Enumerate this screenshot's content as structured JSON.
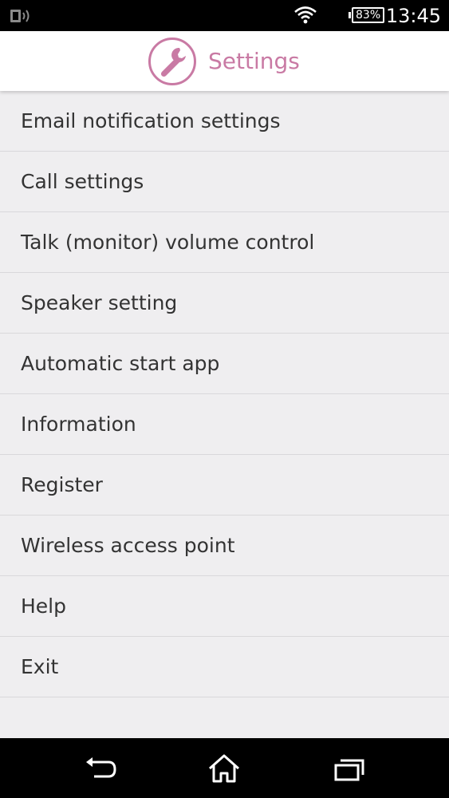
{
  "status_bar": {
    "battery_level": "83%",
    "time": "13:45"
  },
  "header": {
    "title": "Settings",
    "icon": "wrench-icon",
    "accent_color": "#c97aa4"
  },
  "menu": {
    "items": [
      {
        "label": "Email notification settings"
      },
      {
        "label": "Call settings"
      },
      {
        "label": "Talk (monitor) volume control"
      },
      {
        "label": "Speaker setting"
      },
      {
        "label": "Automatic start app"
      },
      {
        "label": "Information"
      },
      {
        "label": "Register"
      },
      {
        "label": "Wireless access point"
      },
      {
        "label": "Help"
      },
      {
        "label": "Exit"
      }
    ]
  },
  "nav_bar": {
    "icons": [
      "back-icon",
      "home-icon",
      "recent-apps-icon"
    ]
  }
}
